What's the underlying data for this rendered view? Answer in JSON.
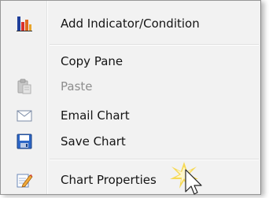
{
  "menu": {
    "items": [
      {
        "label": "Add Indicator/Condition",
        "icon": "bar-chart-icon",
        "enabled": true
      },
      {
        "label": "Copy Pane",
        "icon": "",
        "enabled": true
      },
      {
        "label": "Paste",
        "icon": "paste-icon",
        "enabled": false
      },
      {
        "label": "Email Chart",
        "icon": "envelope-icon",
        "enabled": true
      },
      {
        "label": "Save Chart",
        "icon": "floppy-disk-icon",
        "enabled": true
      },
      {
        "label": "Chart Properties",
        "icon": "pencil-notepad-icon",
        "enabled": true
      }
    ]
  },
  "colors": {
    "accent_red": "#d9302b",
    "accent_blue": "#1f5fbf",
    "highlight_glow": "#f7d53a"
  }
}
